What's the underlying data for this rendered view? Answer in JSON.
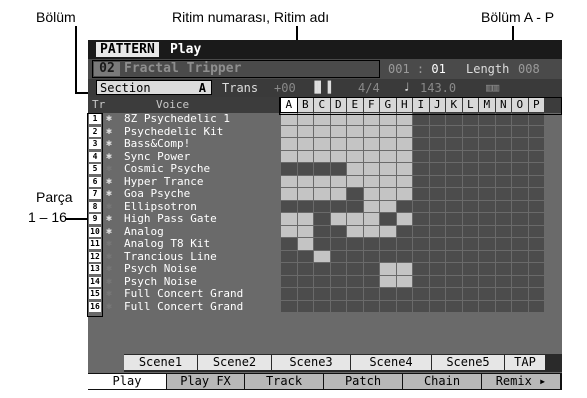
{
  "callouts": {
    "section": "Bölüm",
    "pattern_no_name": "Ritim numarası, Ritim adı",
    "section_range": "Bölüm A - P",
    "part_line1": "Parça",
    "part_line2": "1 – 16"
  },
  "header": {
    "mode": "PATTERN",
    "submode": "Play"
  },
  "pattern": {
    "number": "02",
    "name": "Fractal Tripper",
    "measure": "001",
    "beat": "01",
    "length_label": "Length",
    "length_value": "008"
  },
  "section": {
    "label": "Section",
    "value": "A"
  },
  "trans": {
    "label": "Trans",
    "value": "+00"
  },
  "time_signature": "4/4",
  "tempo": "143.0",
  "track_header": "Tr",
  "voice_header": "Voice",
  "section_letters": [
    "A",
    "B",
    "C",
    "D",
    "E",
    "F",
    "G",
    "H",
    "I",
    "J",
    "K",
    "L",
    "M",
    "N",
    "O",
    "P"
  ],
  "tracks": [
    {
      "num": "1",
      "voice": "8Z Psychedelic 1",
      "active": true
    },
    {
      "num": "2",
      "voice": "Psychedelic Kit",
      "active": true
    },
    {
      "num": "3",
      "voice": "Bass&Comp!",
      "active": true
    },
    {
      "num": "4",
      "voice": "Sync Power",
      "active": true
    },
    {
      "num": "5",
      "voice": "Cosmic Psyche",
      "active": false
    },
    {
      "num": "6",
      "voice": "Hyper Trance",
      "active": true
    },
    {
      "num": "7",
      "voice": "Goa Psyche",
      "active": true
    },
    {
      "num": "8",
      "voice": "Ellipsotron",
      "active": false
    },
    {
      "num": "9",
      "voice": "High Pass Gate",
      "active": true
    },
    {
      "num": "10",
      "voice": "Analog",
      "active": true
    },
    {
      "num": "11",
      "voice": "Analog T8 Kit",
      "active": false
    },
    {
      "num": "12",
      "voice": "Trancious Line",
      "active": false
    },
    {
      "num": "13",
      "voice": "Psych Noise",
      "active": false
    },
    {
      "num": "14",
      "voice": "Psych Noise",
      "active": false
    },
    {
      "num": "15",
      "voice": "Full Concert Grand",
      "active": false
    },
    {
      "num": "16",
      "voice": "Full Concert Grand",
      "active": false
    }
  ],
  "grid": [
    "1111111100000000",
    "1111111100000000",
    "1111111100000000",
    "1111111100000000",
    "0000111100000000",
    "1111111100000000",
    "1111011100000000",
    "0000011000000000",
    "1101110100000000",
    "1100111000000000",
    "0100000000000000",
    "0010000000000000",
    "0000001100000000",
    "0000001100000000",
    "0000000000000000",
    "0000000000000000"
  ],
  "scenes": [
    "Scene1",
    "Scene2",
    "Scene3",
    "Scene4",
    "Scene5",
    "TAP"
  ],
  "tabs": [
    "Play",
    "Play FX",
    "Track",
    "Patch",
    "Chain",
    "Remix ▸"
  ],
  "active_tab": "Play",
  "icons": {
    "track_icon": "gear-icon",
    "tempo_icon": "note-icon",
    "beat_icon": "meter-icon",
    "keyboard_icon": "keyboard-icon"
  },
  "colors": {
    "screen_bg": "#6a6a6a",
    "cell_on": "#c4c4c4",
    "cell_off": "#4c4c4c",
    "header_bg": "#1a1a1a"
  }
}
